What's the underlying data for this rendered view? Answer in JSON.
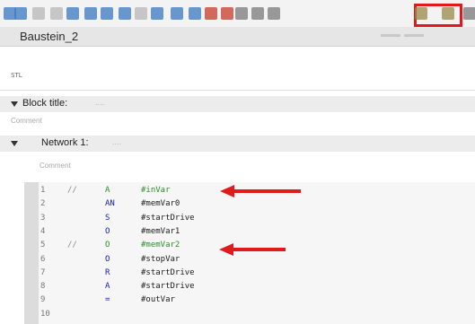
{
  "toolbar": {
    "icons": [
      {
        "name": "insert-network-icon",
        "color": "#3a78c2"
      },
      {
        "name": "delete-network-icon",
        "color": "#3a78c2"
      },
      {
        "name": "insert-row-icon",
        "color": "#b7b7b7"
      },
      {
        "name": "insert-contact-icon",
        "color": "#b7b7b7"
      },
      {
        "name": "open-branch-icon",
        "color": "#3a78c2"
      },
      {
        "name": "close-branch-icon",
        "color": "#3a78c2"
      },
      {
        "name": "list-view-icon",
        "color": "#3a78c2"
      },
      {
        "name": "box-icon",
        "color": "#3a78c2"
      },
      {
        "name": "absolute-operand-icon",
        "color": "#b7b7b7"
      },
      {
        "name": "expand-icon",
        "color": "#3a78c2"
      },
      {
        "name": "collapse-icon",
        "color": "#3a78c2"
      },
      {
        "name": "display-favorites-icon",
        "color": "#3a78c2"
      },
      {
        "name": "go-to-previous-error-icon",
        "color": "#c83a2a"
      },
      {
        "name": "go-to-next-error-icon",
        "color": "#c83a2a"
      },
      {
        "name": "update-block-calls-icon",
        "color": "#7a7a7a"
      },
      {
        "name": "absolute-address-icon",
        "color": "#7a7a7a"
      },
      {
        "name": "tag-information-icon",
        "color": "#7a7a7a"
      },
      {
        "name": "comment-lines-icon",
        "color": "#9a8a4a"
      },
      {
        "name": "uncomment-lines-icon",
        "color": "#9a8a4a"
      },
      {
        "name": "overflow-icon",
        "color": "#7a7a7a"
      }
    ],
    "highlight_color": "#e0191c"
  },
  "editor": {
    "block_name": "Baustein_2",
    "language_label": "STL",
    "block_title_label": "Block title:",
    "block_title_placeholder": "....",
    "block_comment": "Comment",
    "network_label": "Network 1:",
    "network_placeholder": "....",
    "network_comment": "Comment"
  },
  "code": {
    "lines": [
      {
        "num": "1",
        "comment": "//",
        "op": "A",
        "var": "#inVar",
        "commented": true
      },
      {
        "num": "2",
        "comment": "",
        "op": "AN",
        "var": "#memVar0",
        "commented": false
      },
      {
        "num": "3",
        "comment": "",
        "op": "S",
        "var": "#startDrive",
        "commented": false
      },
      {
        "num": "4",
        "comment": "",
        "op": "O",
        "var": "#memVar1",
        "commented": false
      },
      {
        "num": "5",
        "comment": "//",
        "op": "O",
        "var": "#memVar2",
        "commented": true
      },
      {
        "num": "6",
        "comment": "",
        "op": "O",
        "var": "#stopVar",
        "commented": false
      },
      {
        "num": "7",
        "comment": "",
        "op": "R",
        "var": "#startDrive",
        "commented": false
      },
      {
        "num": "8",
        "comment": "",
        "op": "A",
        "var": "#startDrive",
        "commented": false
      },
      {
        "num": "9",
        "comment": "",
        "op": "=",
        "var": "#outVar",
        "commented": false
      },
      {
        "num": "10",
        "comment": "",
        "op": "",
        "var": "",
        "commented": false
      }
    ],
    "commented_color": "#2e8b2e",
    "arrow_color": "#e11b1b"
  }
}
